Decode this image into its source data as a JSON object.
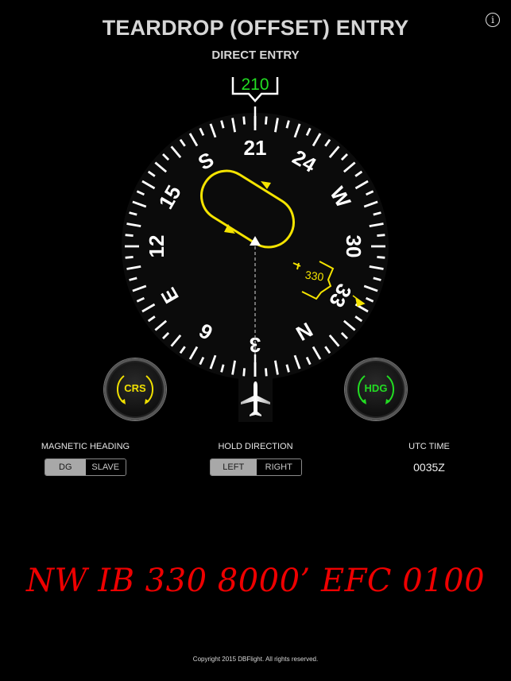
{
  "header": {
    "title": "TEARDROP (OFFSET) ENTRY",
    "subtitle": "DIRECT ENTRY",
    "info_icon": "info-icon",
    "info_glyph": "i"
  },
  "compass": {
    "heading": 210,
    "heading_readout": "210",
    "cardinal_labels": {
      "0": "N",
      "90": "E",
      "180": "S",
      "270": "W"
    },
    "numeric_labels": {
      "30": "3",
      "60": "6",
      "120": "12",
      "150": "15",
      "210": "21",
      "240": "24",
      "300": "30",
      "330": "33"
    },
    "course_bug": {
      "value": 330,
      "label": "330"
    },
    "colors": {
      "heading_readout": "#22dd22",
      "hold": "#f5e400",
      "card": "#0b0b0b",
      "ticks": "#ffffff"
    },
    "hold_pattern": {
      "direction": "left",
      "inbound_course": 330,
      "entry": "Teardrop (offset)"
    },
    "aircraft_icon": "airplane-icon"
  },
  "knobs": {
    "crs": {
      "label": "CRS",
      "color": "#f0e000",
      "icon": "rotate-arrows-icon"
    },
    "hdg": {
      "label": "HDG",
      "color": "#22dd22",
      "icon": "rotate-arrows-icon"
    }
  },
  "controls": {
    "magnetic_heading": {
      "label": "MAGNETIC HEADING",
      "options": [
        "DG",
        "SLAVE"
      ],
      "selected": "DG"
    },
    "hold_direction": {
      "label": "HOLD DIRECTION",
      "options": [
        "LEFT",
        "RIGHT"
      ],
      "selected": "LEFT"
    },
    "utc": {
      "label": "UTC TIME",
      "value": "0035Z"
    }
  },
  "clearance": "NW IB 330 8000’ EFC 0100",
  "footer": {
    "copyright": "Copyright 2015 DBFlight. All rights reserved."
  }
}
